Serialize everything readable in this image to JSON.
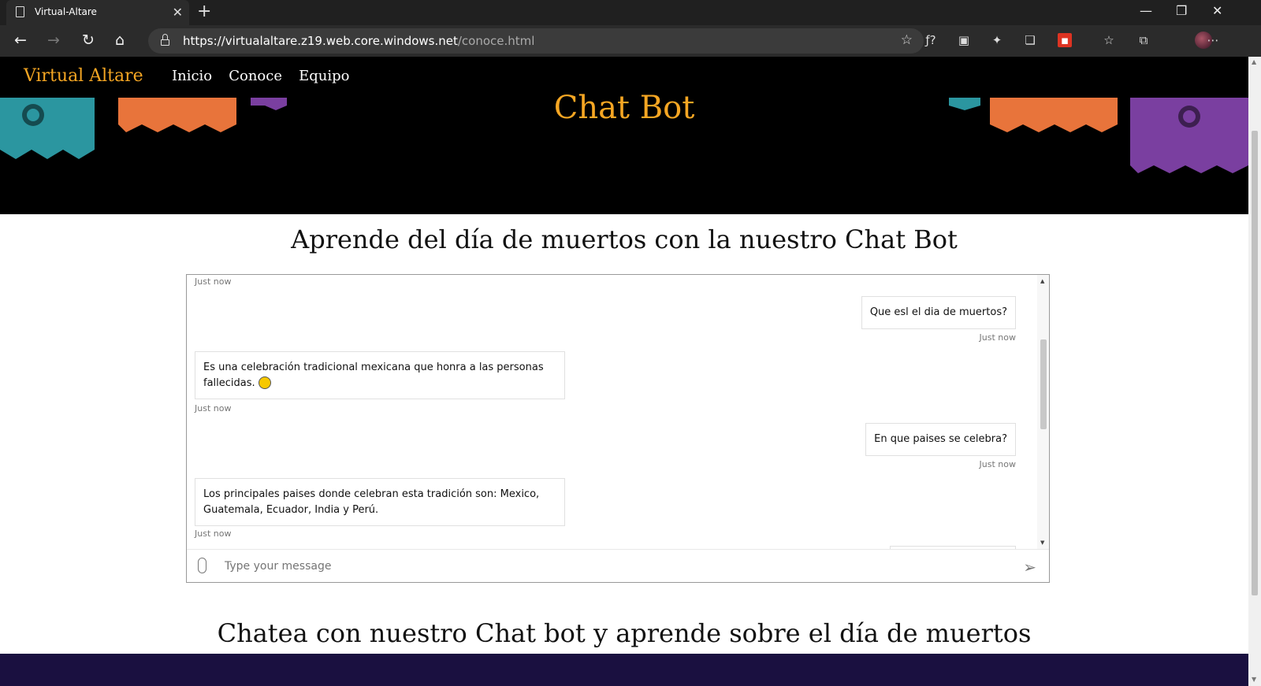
{
  "browser": {
    "tab_title": "Virtual-Altare",
    "url_host": "https://virtualaltare.z19.web.core.windows.net",
    "url_path": "/conoce.html"
  },
  "site": {
    "brand": "Virtual Altare",
    "nav": [
      "Inicio",
      "Conoce",
      "Equipo"
    ],
    "hero_title": "Chat Bot",
    "section_title": "Aprende del día de muertos con la nuestro Chat Bot",
    "section_title_2": "Chatea con nuestro Chat bot y aprende sobre el día de muertos"
  },
  "chat": {
    "messages": [
      {
        "from": "bot",
        "timestamp": "Just now"
      },
      {
        "from": "user",
        "text": "Que esl el dia de muertos?",
        "timestamp": "Just now"
      },
      {
        "from": "bot",
        "text": "Es una celebración tradicional mexicana que honra a las personas fallecidas.",
        "timestamp": "Just now"
      },
      {
        "from": "user",
        "text": "En que paises se celebra?",
        "timestamp": "Just now"
      },
      {
        "from": "bot",
        "text": "Los principales paises donde celebran esta tradición son: Mexico, Guatemala, Ecuador, India y Perú.",
        "timestamp": "Just now"
      }
    ],
    "input_placeholder": "Type your message"
  },
  "colors": {
    "brand": "#f5a623",
    "hero_bg": "#000000",
    "banner_teal": "#2b96a0",
    "banner_orange": "#e8743b",
    "banner_purple": "#7a3fa0"
  }
}
